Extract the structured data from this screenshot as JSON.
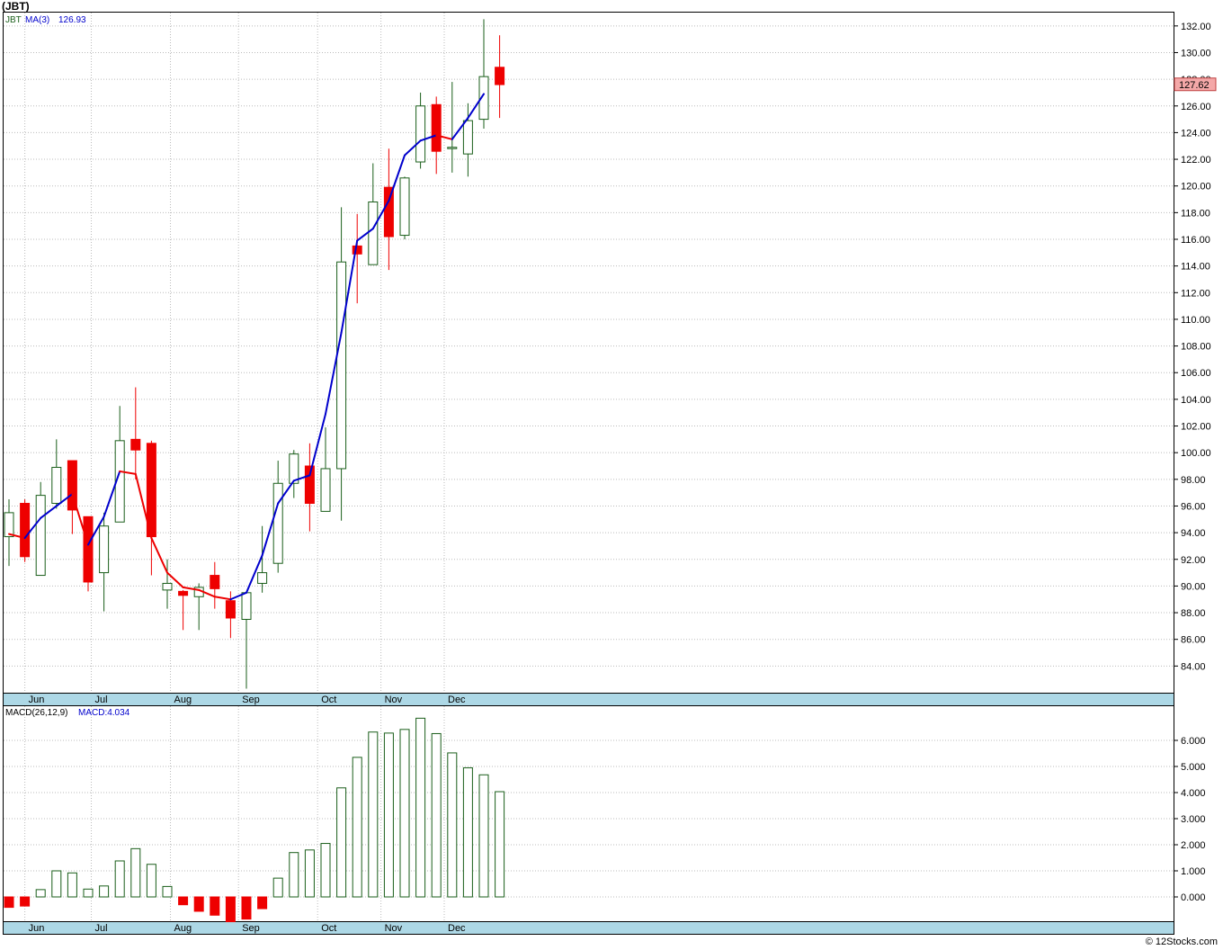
{
  "title": "(JBT)",
  "footer": "© 12Stocks.com",
  "colors": {
    "up": "#1a5e1a",
    "down": "#ee0000",
    "ma_up": "#0000cc",
    "ma_down": "#ee0000",
    "axis_band": "#add8e6",
    "price_badge_bg": "#f4a8a8",
    "grid": "#bbbbbb"
  },
  "chart_data": [
    {
      "type": "candlestick",
      "legend": {
        "symbol": "JBT",
        "ma_label": "MA(3)",
        "ma_value": "126.93"
      },
      "last_price": "127.62",
      "ylim": [
        82,
        133
      ],
      "y_ticks": [
        84,
        86,
        88,
        90,
        92,
        94,
        96,
        98,
        100,
        102,
        104,
        106,
        108,
        110,
        112,
        114,
        116,
        118,
        120,
        122,
        124,
        126,
        128,
        130,
        132
      ],
      "month_labels": [
        {
          "label": "Jun",
          "index": 1
        },
        {
          "label": "Jul",
          "index": 5.2
        },
        {
          "label": "Aug",
          "index": 10.2
        },
        {
          "label": "Sep",
          "index": 14.5
        },
        {
          "label": "Oct",
          "index": 19.5
        },
        {
          "label": "Nov",
          "index": 23.5
        },
        {
          "label": "Dec",
          "index": 27.5
        }
      ],
      "candles": [
        {
          "o": 93.7,
          "h": 96.5,
          "l": 91.5,
          "c": 95.5
        },
        {
          "o": 96.2,
          "h": 96.5,
          "l": 91.8,
          "c": 92.2
        },
        {
          "o": 90.8,
          "h": 97.8,
          "l": 90.8,
          "c": 96.8
        },
        {
          "o": 96.2,
          "h": 101.0,
          "l": 95.8,
          "c": 98.9
        },
        {
          "o": 99.4,
          "h": 99.4,
          "l": 93.9,
          "c": 95.7
        },
        {
          "o": 95.2,
          "h": 95.2,
          "l": 89.6,
          "c": 90.3
        },
        {
          "o": 91.0,
          "h": 95.5,
          "l": 88.1,
          "c": 94.5
        },
        {
          "o": 94.8,
          "h": 103.5,
          "l": 94.8,
          "c": 100.9
        },
        {
          "o": 101.0,
          "h": 104.9,
          "l": 98.0,
          "c": 100.2
        },
        {
          "o": 100.7,
          "h": 100.9,
          "l": 90.8,
          "c": 93.7
        },
        {
          "o": 89.7,
          "h": 92.0,
          "l": 88.3,
          "c": 90.2
        },
        {
          "o": 89.6,
          "h": 89.7,
          "l": 86.7,
          "c": 89.3
        },
        {
          "o": 89.2,
          "h": 90.2,
          "l": 86.7,
          "c": 89.9
        },
        {
          "o": 90.8,
          "h": 91.8,
          "l": 88.3,
          "c": 89.8
        },
        {
          "o": 88.9,
          "h": 89.6,
          "l": 86.1,
          "c": 87.6
        },
        {
          "o": 87.5,
          "h": 89.6,
          "l": 82.3,
          "c": 89.5
        },
        {
          "o": 90.2,
          "h": 94.5,
          "l": 89.5,
          "c": 91.0
        },
        {
          "o": 91.7,
          "h": 99.4,
          "l": 91.0,
          "c": 97.7
        },
        {
          "o": 97.7,
          "h": 100.2,
          "l": 96.6,
          "c": 99.9
        },
        {
          "o": 99.0,
          "h": 100.7,
          "l": 94.1,
          "c": 96.2
        },
        {
          "o": 95.6,
          "h": 101.9,
          "l": 95.6,
          "c": 98.8
        },
        {
          "o": 98.8,
          "h": 118.4,
          "l": 94.9,
          "c": 114.3
        },
        {
          "o": 115.5,
          "h": 117.9,
          "l": 111.2,
          "c": 114.9
        },
        {
          "o": 114.1,
          "h": 121.7,
          "l": 114.1,
          "c": 118.8
        },
        {
          "o": 119.9,
          "h": 122.8,
          "l": 113.7,
          "c": 116.2
        },
        {
          "o": 116.3,
          "h": 120.7,
          "l": 116.0,
          "c": 120.6
        },
        {
          "o": 121.8,
          "h": 127.0,
          "l": 121.3,
          "c": 126.0
        },
        {
          "o": 126.1,
          "h": 126.7,
          "l": 120.9,
          "c": 122.6
        },
        {
          "o": 122.9,
          "h": 127.8,
          "l": 121.0,
          "c": 122.9
        },
        {
          "o": 122.4,
          "h": 126.2,
          "l": 120.7,
          "c": 124.9
        },
        {
          "o": 125.0,
          "h": 132.5,
          "l": 124.3,
          "c": 128.2
        },
        {
          "o": 128.9,
          "h": 131.3,
          "l": 125.1,
          "c": 127.6
        }
      ],
      "ma3": [
        93.9,
        93.6,
        95.1,
        96.0,
        96.9,
        93.1,
        95.2,
        98.6,
        98.4,
        93.6,
        91.0,
        89.9,
        89.7,
        89.2,
        89.0,
        89.5,
        92.3,
        96.2,
        97.9,
        98.3,
        102.9,
        109.0,
        115.9,
        116.8,
        118.9,
        122.3,
        123.4,
        123.8,
        123.5,
        125.1,
        126.9
      ],
      "ma3_start_index": 0
    },
    {
      "type": "bar",
      "legend": {
        "name": "MACD(26,12,9)",
        "value_label": "MACD:4.034"
      },
      "ylim": [
        -1.0,
        7.0
      ],
      "y_ticks": [
        "0.000",
        "1.000",
        "2.000",
        "3.000",
        "4.000",
        "5.000",
        "6.000"
      ],
      "values": [
        -0.4,
        -0.35,
        0.28,
        1.0,
        0.92,
        0.3,
        0.42,
        1.38,
        1.85,
        1.25,
        0.4,
        -0.3,
        -0.55,
        -0.7,
        -0.95,
        -0.85,
        -0.45,
        0.72,
        1.7,
        1.8,
        2.05,
        4.18,
        5.35,
        6.32,
        6.28,
        6.42,
        6.85,
        6.26,
        5.52,
        4.95,
        4.68,
        4.034
      ],
      "month_labels": [
        {
          "label": "Jun",
          "index": 1
        },
        {
          "label": "Jul",
          "index": 5.2
        },
        {
          "label": "Aug",
          "index": 10.2
        },
        {
          "label": "Sep",
          "index": 14.5
        },
        {
          "label": "Oct",
          "index": 19.5
        },
        {
          "label": "Nov",
          "index": 23.5
        },
        {
          "label": "Dec",
          "index": 27.5
        }
      ]
    }
  ]
}
